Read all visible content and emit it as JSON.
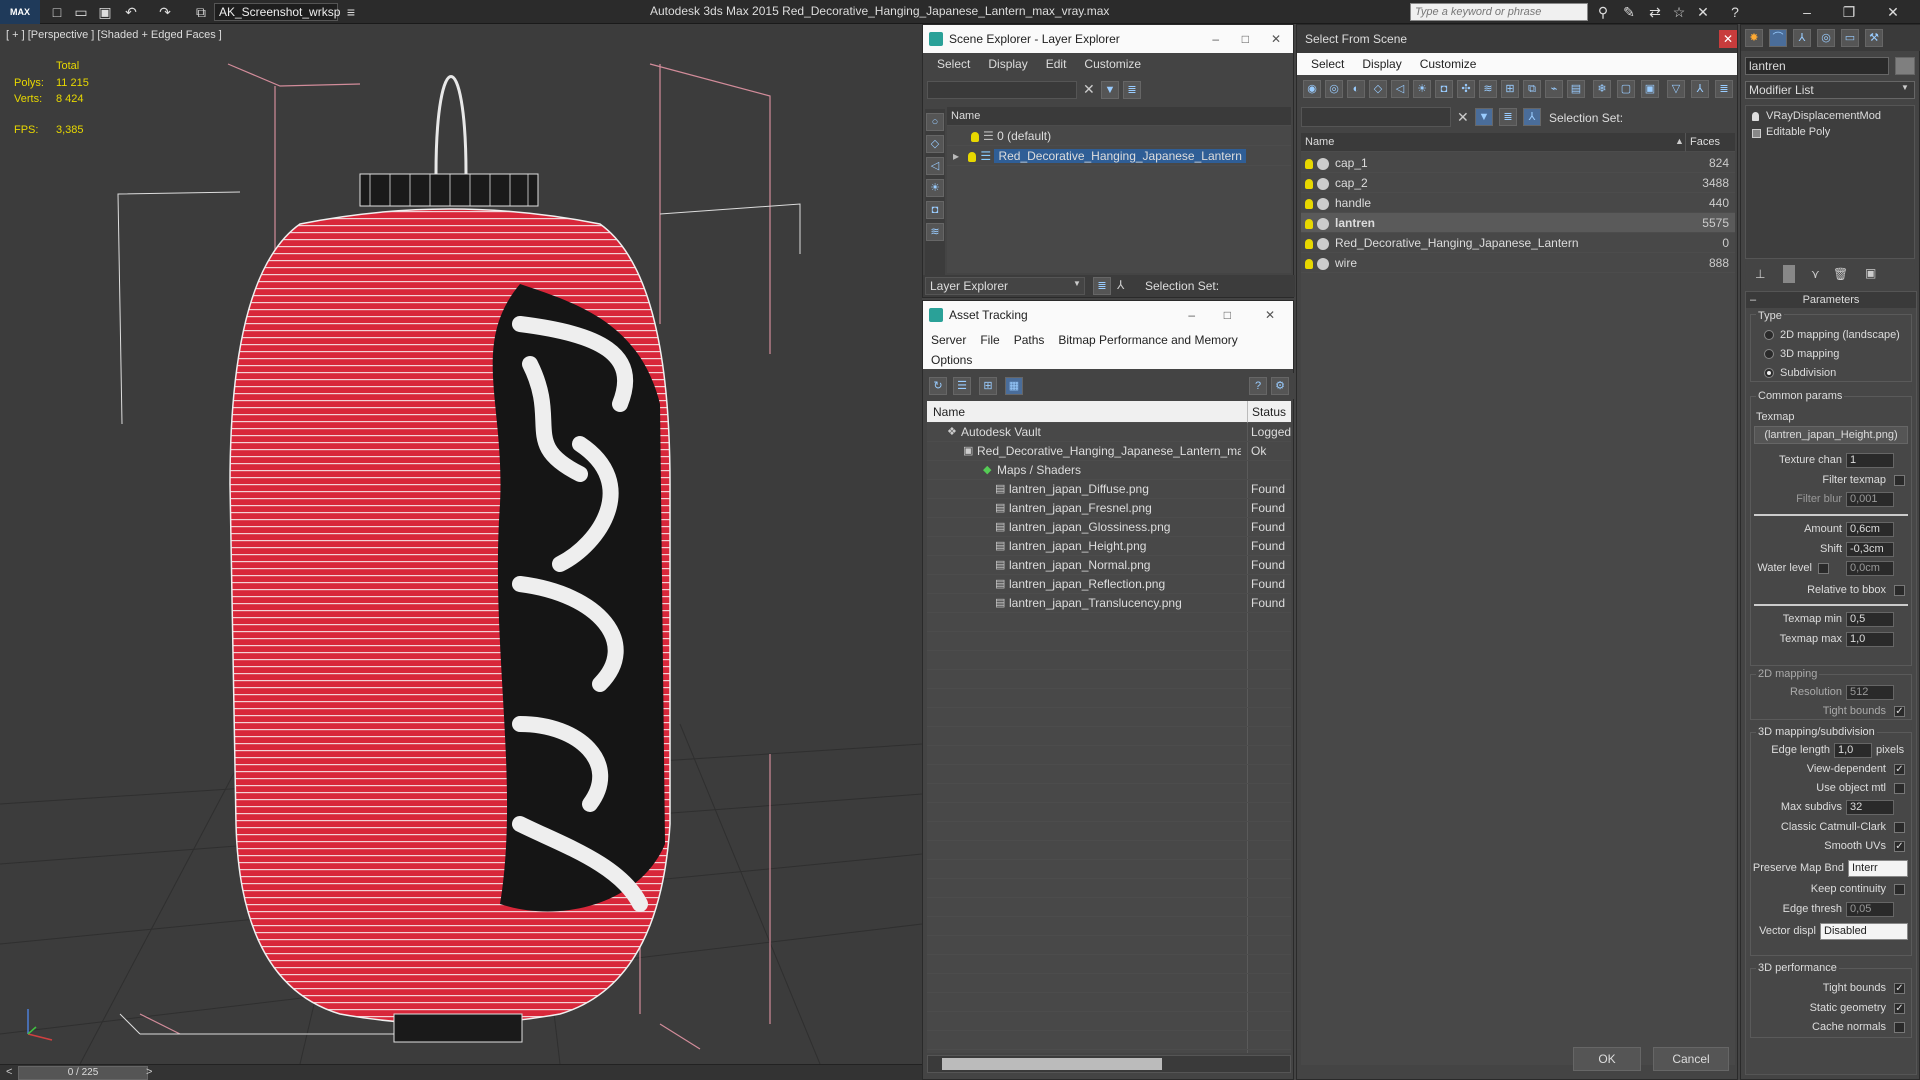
{
  "titlebar": {
    "logo": "MAX",
    "workspace": "AK_Screenshot_wrksp",
    "app_title": "Autodesk 3ds Max  2015    Red_Decorative_Hanging_Japanese_Lantern_max_vray.max",
    "search_placeholder": "Type a keyword or phrase"
  },
  "viewport": {
    "label": "[ + ] [Perspective ] [Shaded + Edged Faces ]",
    "stats": {
      "total_label": "Total",
      "polys_label": "Polys:",
      "polys_value": "11 215",
      "verts_label": "Verts:",
      "verts_value": "8 424",
      "fps_label": "FPS:",
      "fps_value": "3,385"
    }
  },
  "timeline": {
    "frame": "0 / 225",
    "prev": "<",
    "next": ">"
  },
  "scene_explorer": {
    "title": "Scene Explorer - Layer Explorer",
    "menu": [
      "Select",
      "Display",
      "Edit",
      "Customize"
    ],
    "col_name": "Name",
    "rows": [
      "0 (default)",
      "Red_Decorative_Hanging_Japanese_Lantern"
    ],
    "footer_dropdown": "Layer Explorer",
    "footer_selset": "Selection Set:"
  },
  "asset_tracking": {
    "title": "Asset Tracking",
    "menu": [
      "Server",
      "File",
      "Paths",
      "Bitmap Performance and Memory"
    ],
    "menu2": "Options",
    "col_name": "Name",
    "col_status": "Status",
    "rows": [
      {
        "name": "Autodesk Vault",
        "status": "Logged"
      },
      {
        "name": "Red_Decorative_Hanging_Japanese_Lantern_ma...",
        "status": "Ok"
      },
      {
        "name": "Maps / Shaders",
        "status": ""
      },
      {
        "name": "lantren_japan_Diffuse.png",
        "status": "Found"
      },
      {
        "name": "lantren_japan_Fresnel.png",
        "status": "Found"
      },
      {
        "name": "lantren_japan_Glossiness.png",
        "status": "Found"
      },
      {
        "name": "lantren_japan_Height.png",
        "status": "Found"
      },
      {
        "name": "lantren_japan_Normal.png",
        "status": "Found"
      },
      {
        "name": "lantren_japan_Reflection.png",
        "status": "Found"
      },
      {
        "name": "lantren_japan_Translucency.png",
        "status": "Found"
      }
    ]
  },
  "select_from_scene": {
    "title": "Select From Scene",
    "menu": [
      "Select",
      "Display",
      "Customize"
    ],
    "selset": "Selection Set:",
    "col_name": "Name",
    "col_faces": "Faces",
    "rows": [
      {
        "name": "cap_1",
        "faces": "824"
      },
      {
        "name": "cap_2",
        "faces": "3488"
      },
      {
        "name": "handle",
        "faces": "440"
      },
      {
        "name": "lantren",
        "faces": "5575"
      },
      {
        "name": "Red_Decorative_Hanging_Japanese_Lantern",
        "faces": "0"
      },
      {
        "name": "wire",
        "faces": "888"
      }
    ],
    "ok": "OK",
    "cancel": "Cancel"
  },
  "modify": {
    "object_name": "lantren",
    "modifier_list": "Modifier List",
    "stack": [
      "VRayDisplacementMod",
      "Editable Poly"
    ],
    "rollout": "Parameters",
    "type_label": "Type",
    "type_options": [
      "2D mapping (landscape)",
      "3D mapping",
      "Subdivision"
    ],
    "common_params": "Common params",
    "texmap_label": "Texmap",
    "texmap_value": "(lantren_japan_Height.png)",
    "texture_chan": "Texture chan",
    "texture_chan_v": "1",
    "filter_texmap": "Filter texmap",
    "filter_blur": "Filter blur",
    "filter_blur_v": "0,001",
    "amount": "Amount",
    "amount_v": "0,6cm",
    "shift": "Shift",
    "shift_v": "-0,3cm",
    "water_level": "Water level",
    "water_level_v": "0,0cm",
    "relative_bbox": "Relative to bbox",
    "texmap_min": "Texmap min",
    "texmap_min_v": "0,5",
    "texmap_max": "Texmap max",
    "texmap_max_v": "1,0",
    "grp_2d": "2D mapping",
    "resolution": "Resolution",
    "resolution_v": "512",
    "tight_bounds": "Tight bounds",
    "grp_3d": "3D mapping/subdivision",
    "edge_length": "Edge length",
    "edge_length_v": "1,0",
    "pixels": "pixels",
    "view_dependent": "View-dependent",
    "use_object_mtl": "Use object mtl",
    "max_subdivs": "Max subdivs",
    "max_subdivs_v": "32",
    "classic_cc": "Classic Catmull-Clark",
    "smooth_uvs": "Smooth UVs",
    "preserve_map": "Preserve Map Bnd",
    "preserve_map_v": "Interr",
    "keep_continuity": "Keep continuity",
    "edge_thresh": "Edge thresh",
    "edge_thresh_v": "0,05",
    "vector_displ": "Vector displ",
    "vector_displ_v": "Disabled",
    "grp_perf": "3D performance",
    "tight_bounds2": "Tight bounds",
    "static_geometry": "Static geometry",
    "cache_normals": "Cache normals"
  },
  "colors": {
    "lantern_red": "#d8273a",
    "selection": "#2f5e96",
    "stat_yellow": "#e8d800"
  }
}
